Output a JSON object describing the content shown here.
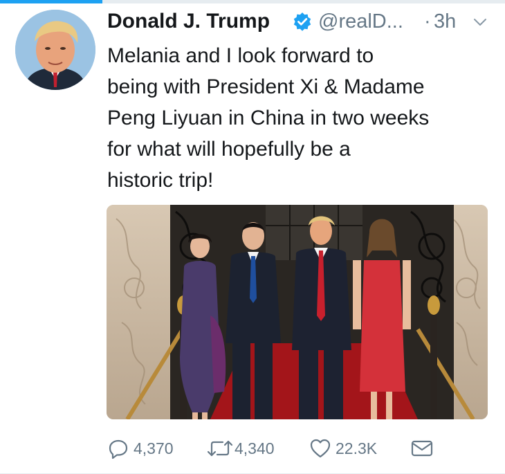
{
  "tweet": {
    "author_name": "Donald J. Trump",
    "handle": "@realD...",
    "separator": "·",
    "time": "3h",
    "text_lines": [
      "Melania and I look forward to",
      "being with President Xi & Madame",
      "Peng Liyuan in China in two weeks",
      "for what will hopefully be a",
      "historic trip!"
    ]
  },
  "actions": {
    "replies": "4,370",
    "retweets": "4,340",
    "likes": "22.3K"
  },
  "icons": {
    "verified": "verified-badge-icon",
    "menu": "chevron-down-icon",
    "reply": "reply-icon",
    "retweet": "retweet-icon",
    "like": "heart-icon",
    "message": "envelope-icon"
  },
  "colors": {
    "accent": "#1da1f2",
    "secondary_text": "#657786",
    "primary_text": "#14171a"
  }
}
